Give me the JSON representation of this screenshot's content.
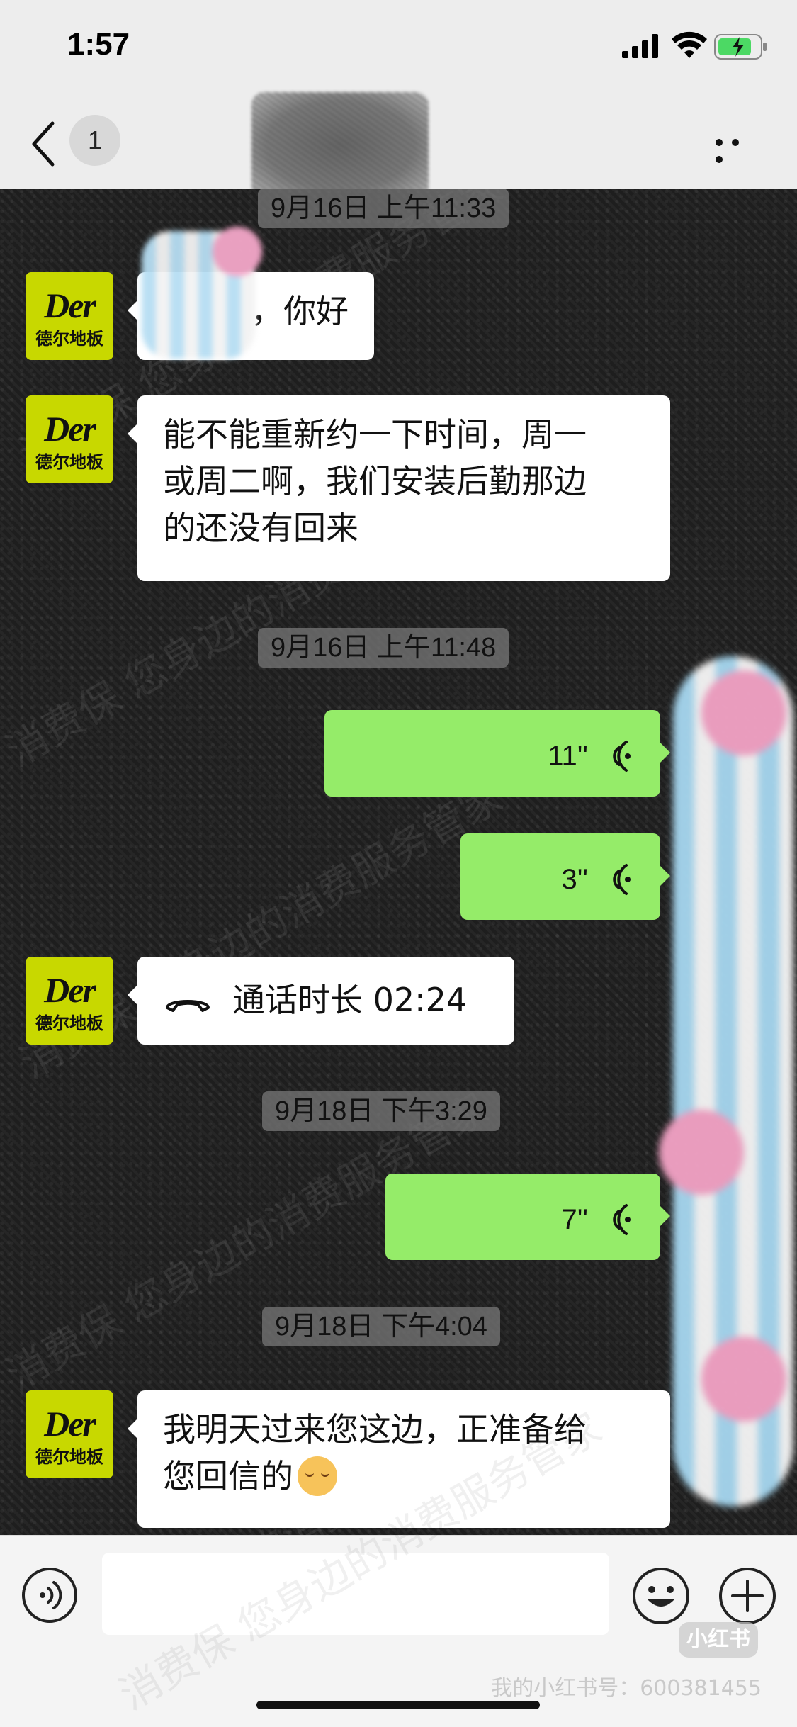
{
  "status_bar": {
    "time": "1:57"
  },
  "nav": {
    "unread_count": "1"
  },
  "watermark_text": "消费保 您身边的消费服务管家",
  "avatar": {
    "brand": "Der",
    "brand_sub": "德尔地板"
  },
  "messages": [
    {
      "type": "timestamp",
      "text": "9月16日 上午11:33"
    },
    {
      "type": "text",
      "from": "contact",
      "text": "，你好"
    },
    {
      "type": "text",
      "from": "contact",
      "lines": [
        "能不能重新约一下时间，周一",
        "或周二啊，我们安装后勤那边",
        "的还没有回来"
      ]
    },
    {
      "type": "timestamp",
      "text": "9月16日 上午11:48"
    },
    {
      "type": "voice",
      "from": "me",
      "duration": "11''"
    },
    {
      "type": "voice",
      "from": "me",
      "duration": "3''"
    },
    {
      "type": "call",
      "from": "contact",
      "text": "通话时长 02:24"
    },
    {
      "type": "timestamp",
      "text": "9月18日 下午3:29"
    },
    {
      "type": "voice",
      "from": "me",
      "duration": "7''"
    },
    {
      "type": "timestamp",
      "text": "9月18日 下午4:04"
    },
    {
      "type": "text",
      "from": "contact",
      "lines": [
        "我明天过来您这边，正准备给",
        "您回信的"
      ]
    }
  ],
  "input": {
    "value": "",
    "placeholder": ""
  },
  "footer": {
    "logo": "小红书",
    "account": "我的小红书号：600381455"
  },
  "icons": {
    "back": "chevron-left-icon",
    "more": "more-icon",
    "voice": "voice-wave-icon",
    "call": "phone-hangup-icon",
    "voice_toggle": "voice-input-icon",
    "emoji": "emoji-icon",
    "add": "plus-icon"
  },
  "colors": {
    "outgoing_bubble": "#95ec69",
    "incoming_bubble": "#ffffff",
    "avatar_bg": "#c8d800",
    "header_bg": "#ededed"
  }
}
